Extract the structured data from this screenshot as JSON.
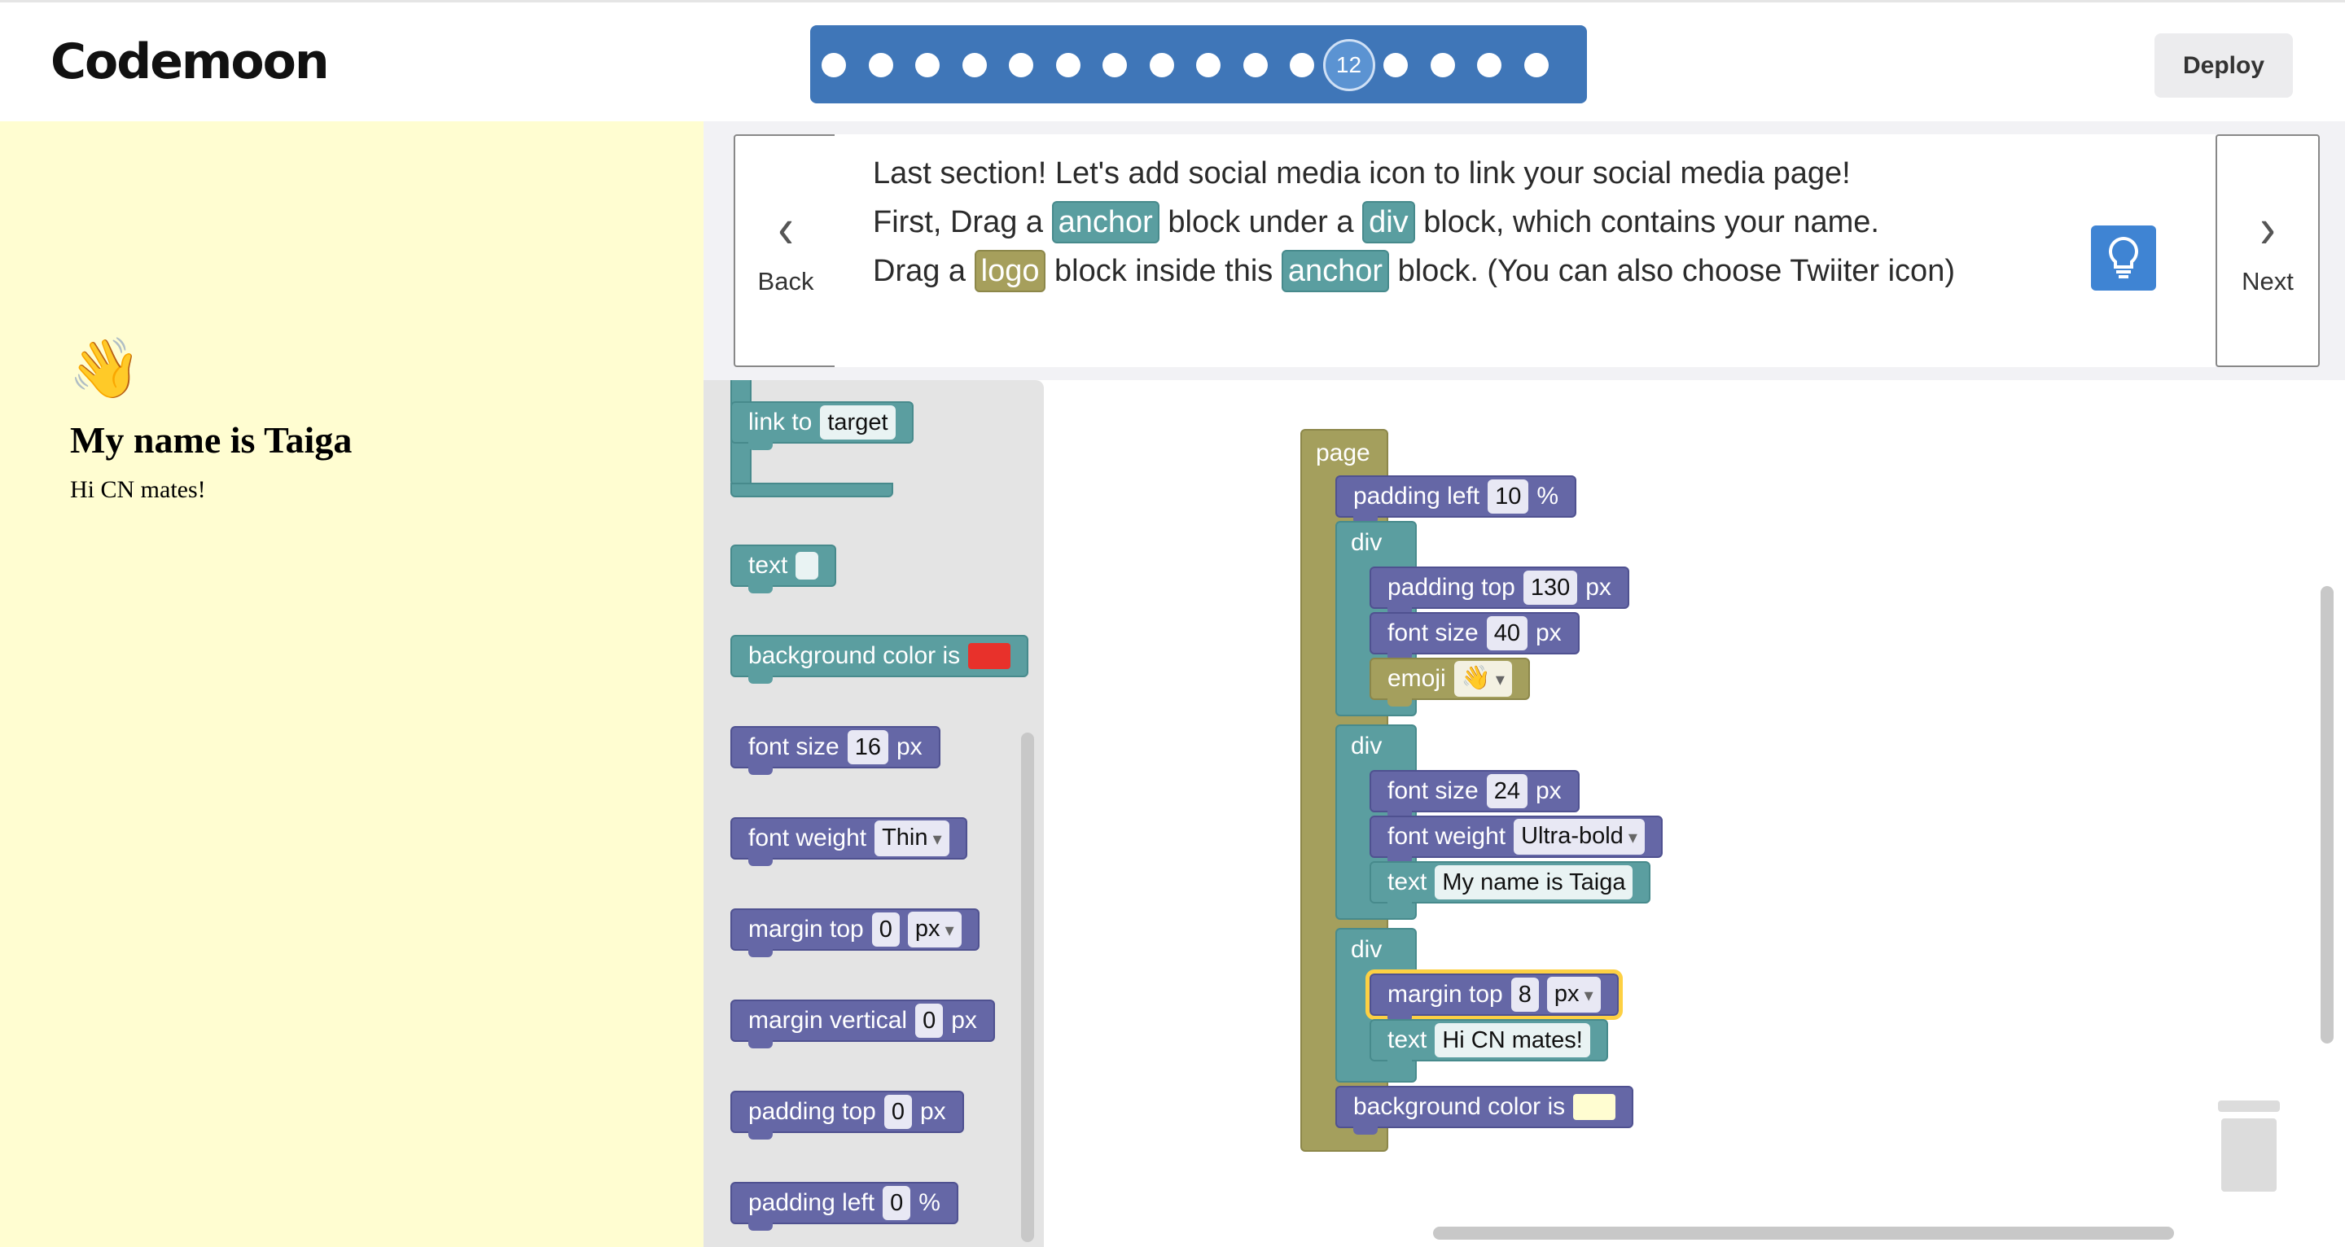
{
  "header": {
    "logo": "Codemoon",
    "progress": {
      "total_steps": 16,
      "current_step": 12,
      "current_label": "12"
    },
    "deploy_label": "Deploy"
  },
  "preview": {
    "emoji": "👋",
    "name": "My name is Taiga",
    "subtitle": "Hi CN mates!",
    "background_color": "#fffdd1"
  },
  "instructions": {
    "back_label": "Back",
    "next_label": "Next",
    "line1": "Last section! Let's add social media icon to link your social media page!",
    "line2": {
      "a": "First, Drag a ",
      "tag1": "anchor",
      "b": " block under a ",
      "tag2": "div",
      "c": " block, which contains your name."
    },
    "line3": {
      "a": "Drag a ",
      "tag1": "logo",
      "b": " block inside this ",
      "tag2": "anchor",
      "c": " block. (You can also choose Twiiter icon)"
    },
    "hint_icon": "lightbulb-icon"
  },
  "flyout": {
    "anchor_label": "link to",
    "anchor_target": "target",
    "text_label": "text",
    "bg_label": "background color is",
    "bg_color": "#e8312b",
    "font_size_label": "font size",
    "font_size_value": "16",
    "font_size_unit": "px",
    "font_weight_label": "font weight",
    "font_weight_value": "Thin",
    "margin_top_label": "margin top",
    "margin_top_value": "0",
    "margin_top_unit": "px",
    "margin_vertical_label": "margin vertical",
    "margin_vertical_value": "0",
    "margin_vertical_unit": "px",
    "padding_top_label": "padding top",
    "padding_top_value": "0",
    "padding_top_unit": "px",
    "padding_left_label": "padding left",
    "padding_left_value": "0",
    "padding_left_unit": "%"
  },
  "program": {
    "page_label": "page",
    "padding_left": {
      "label": "padding left",
      "value": "10",
      "unit": "%"
    },
    "div1": {
      "label": "div",
      "padding_top": {
        "label": "padding top",
        "value": "130",
        "unit": "px"
      },
      "font_size": {
        "label": "font size",
        "value": "40",
        "unit": "px"
      },
      "emoji": {
        "label": "emoji",
        "value": "👋"
      }
    },
    "div2": {
      "label": "div",
      "font_size": {
        "label": "font size",
        "value": "24",
        "unit": "px"
      },
      "font_weight": {
        "label": "font weight",
        "value": "Ultra-bold"
      },
      "text": {
        "label": "text",
        "value": "My name is Taiga"
      }
    },
    "div3": {
      "label": "div",
      "margin_top": {
        "label": "margin top",
        "value": "8",
        "unit": "px"
      },
      "text": {
        "label": "text",
        "value": "Hi CN mates!"
      }
    },
    "background": {
      "label": "background color is",
      "color": "#fffdd1"
    }
  },
  "colors": {
    "accent": "#3f76b8",
    "block_style": "#6567a6",
    "block_content": "#5b9ea0",
    "block_page": "#a49f5d"
  }
}
